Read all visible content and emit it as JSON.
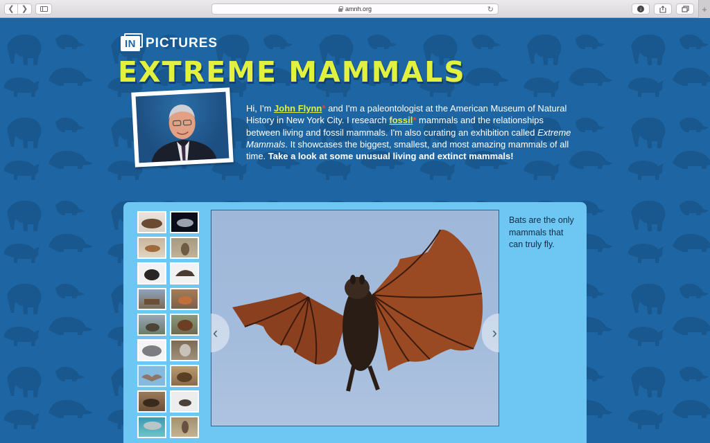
{
  "browser": {
    "url": "amnh.org",
    "back_icon": "chevron-left-icon",
    "forward_icon": "chevron-right-icon",
    "new_tab_label": "+"
  },
  "header": {
    "logo_in": "IN",
    "logo_pictures": "PICTURES",
    "title": "EXTREME MAMMALS"
  },
  "intro": {
    "greeting": "Hi, I'm ",
    "name_link": "John Flynn",
    "asterisk": "*",
    "text_1": " and I'm a paleontologist at the American Museum of Natural History in New York City. I research ",
    "fossil_link": "fossil",
    "text_2": " mammals and the relationships between living and fossil mammals. I'm also curating an exhibition called ",
    "exhibit_name": "Extreme Mammals",
    "text_3": ". It showcases the biggest, smallest, and most amazing mammals of all time. ",
    "cta": "Take a look at some unusual living and extinct mammals!"
  },
  "gallery": {
    "caption": "Bats are the only mammals that can truly fly.",
    "prev_label": "‹",
    "next_label": "›",
    "selected_index": 12,
    "thumbnail_count": 18
  },
  "colors": {
    "page_bg": "#1e66a3",
    "title_yellow": "#e2f140",
    "panel_blue": "#6dc7f2",
    "asterisk_red": "#e2473a"
  }
}
